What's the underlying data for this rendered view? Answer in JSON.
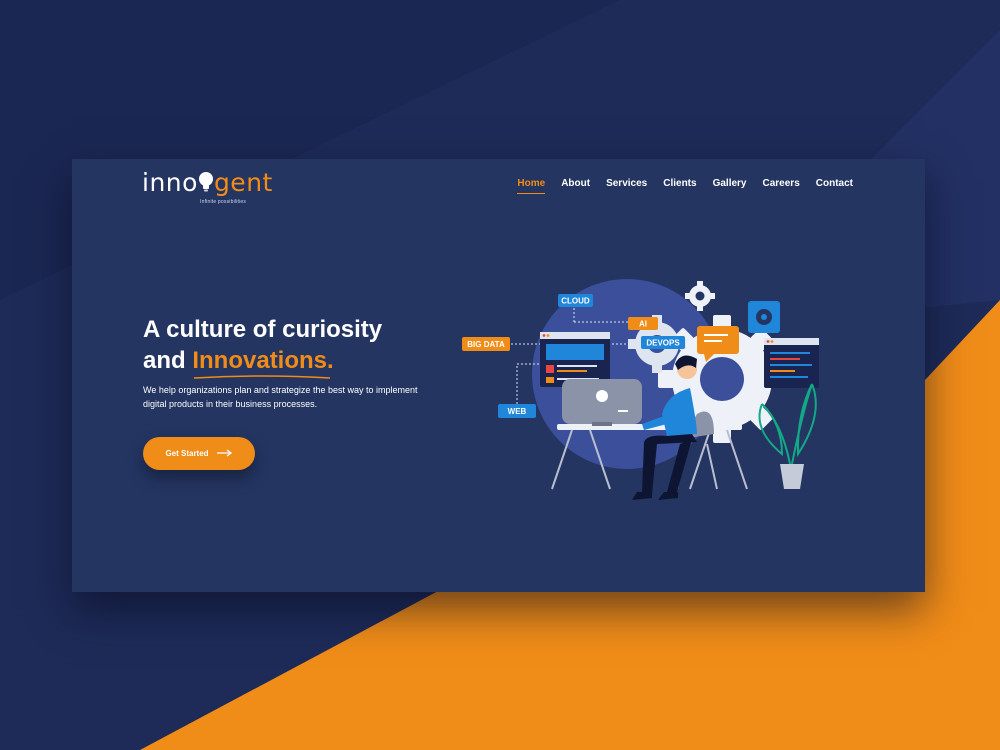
{
  "brand": {
    "name_part1": "inno",
    "name_part2": "gent",
    "tagline": "Infinite possibilities",
    "accent_color": "#f08c18",
    "primary_color": "#243562"
  },
  "nav": {
    "items": [
      {
        "label": "Home",
        "active": true
      },
      {
        "label": "About"
      },
      {
        "label": "Services"
      },
      {
        "label": "Clients"
      },
      {
        "label": "Gallery"
      },
      {
        "label": "Careers"
      },
      {
        "label": "Contact"
      }
    ]
  },
  "hero": {
    "title_line1": "A culture of curiosity",
    "title_and": "and ",
    "title_accent": "Innovations.",
    "description": "We help organizations plan and strategize the best way to implement digital products in their business processes.",
    "cta_label": "Get Started",
    "cta_icon": "arrow-right-icon"
  },
  "illustration": {
    "tags": [
      "CLOUD",
      "AI",
      "DEVOPS",
      "BIG DATA",
      "WEB"
    ]
  }
}
